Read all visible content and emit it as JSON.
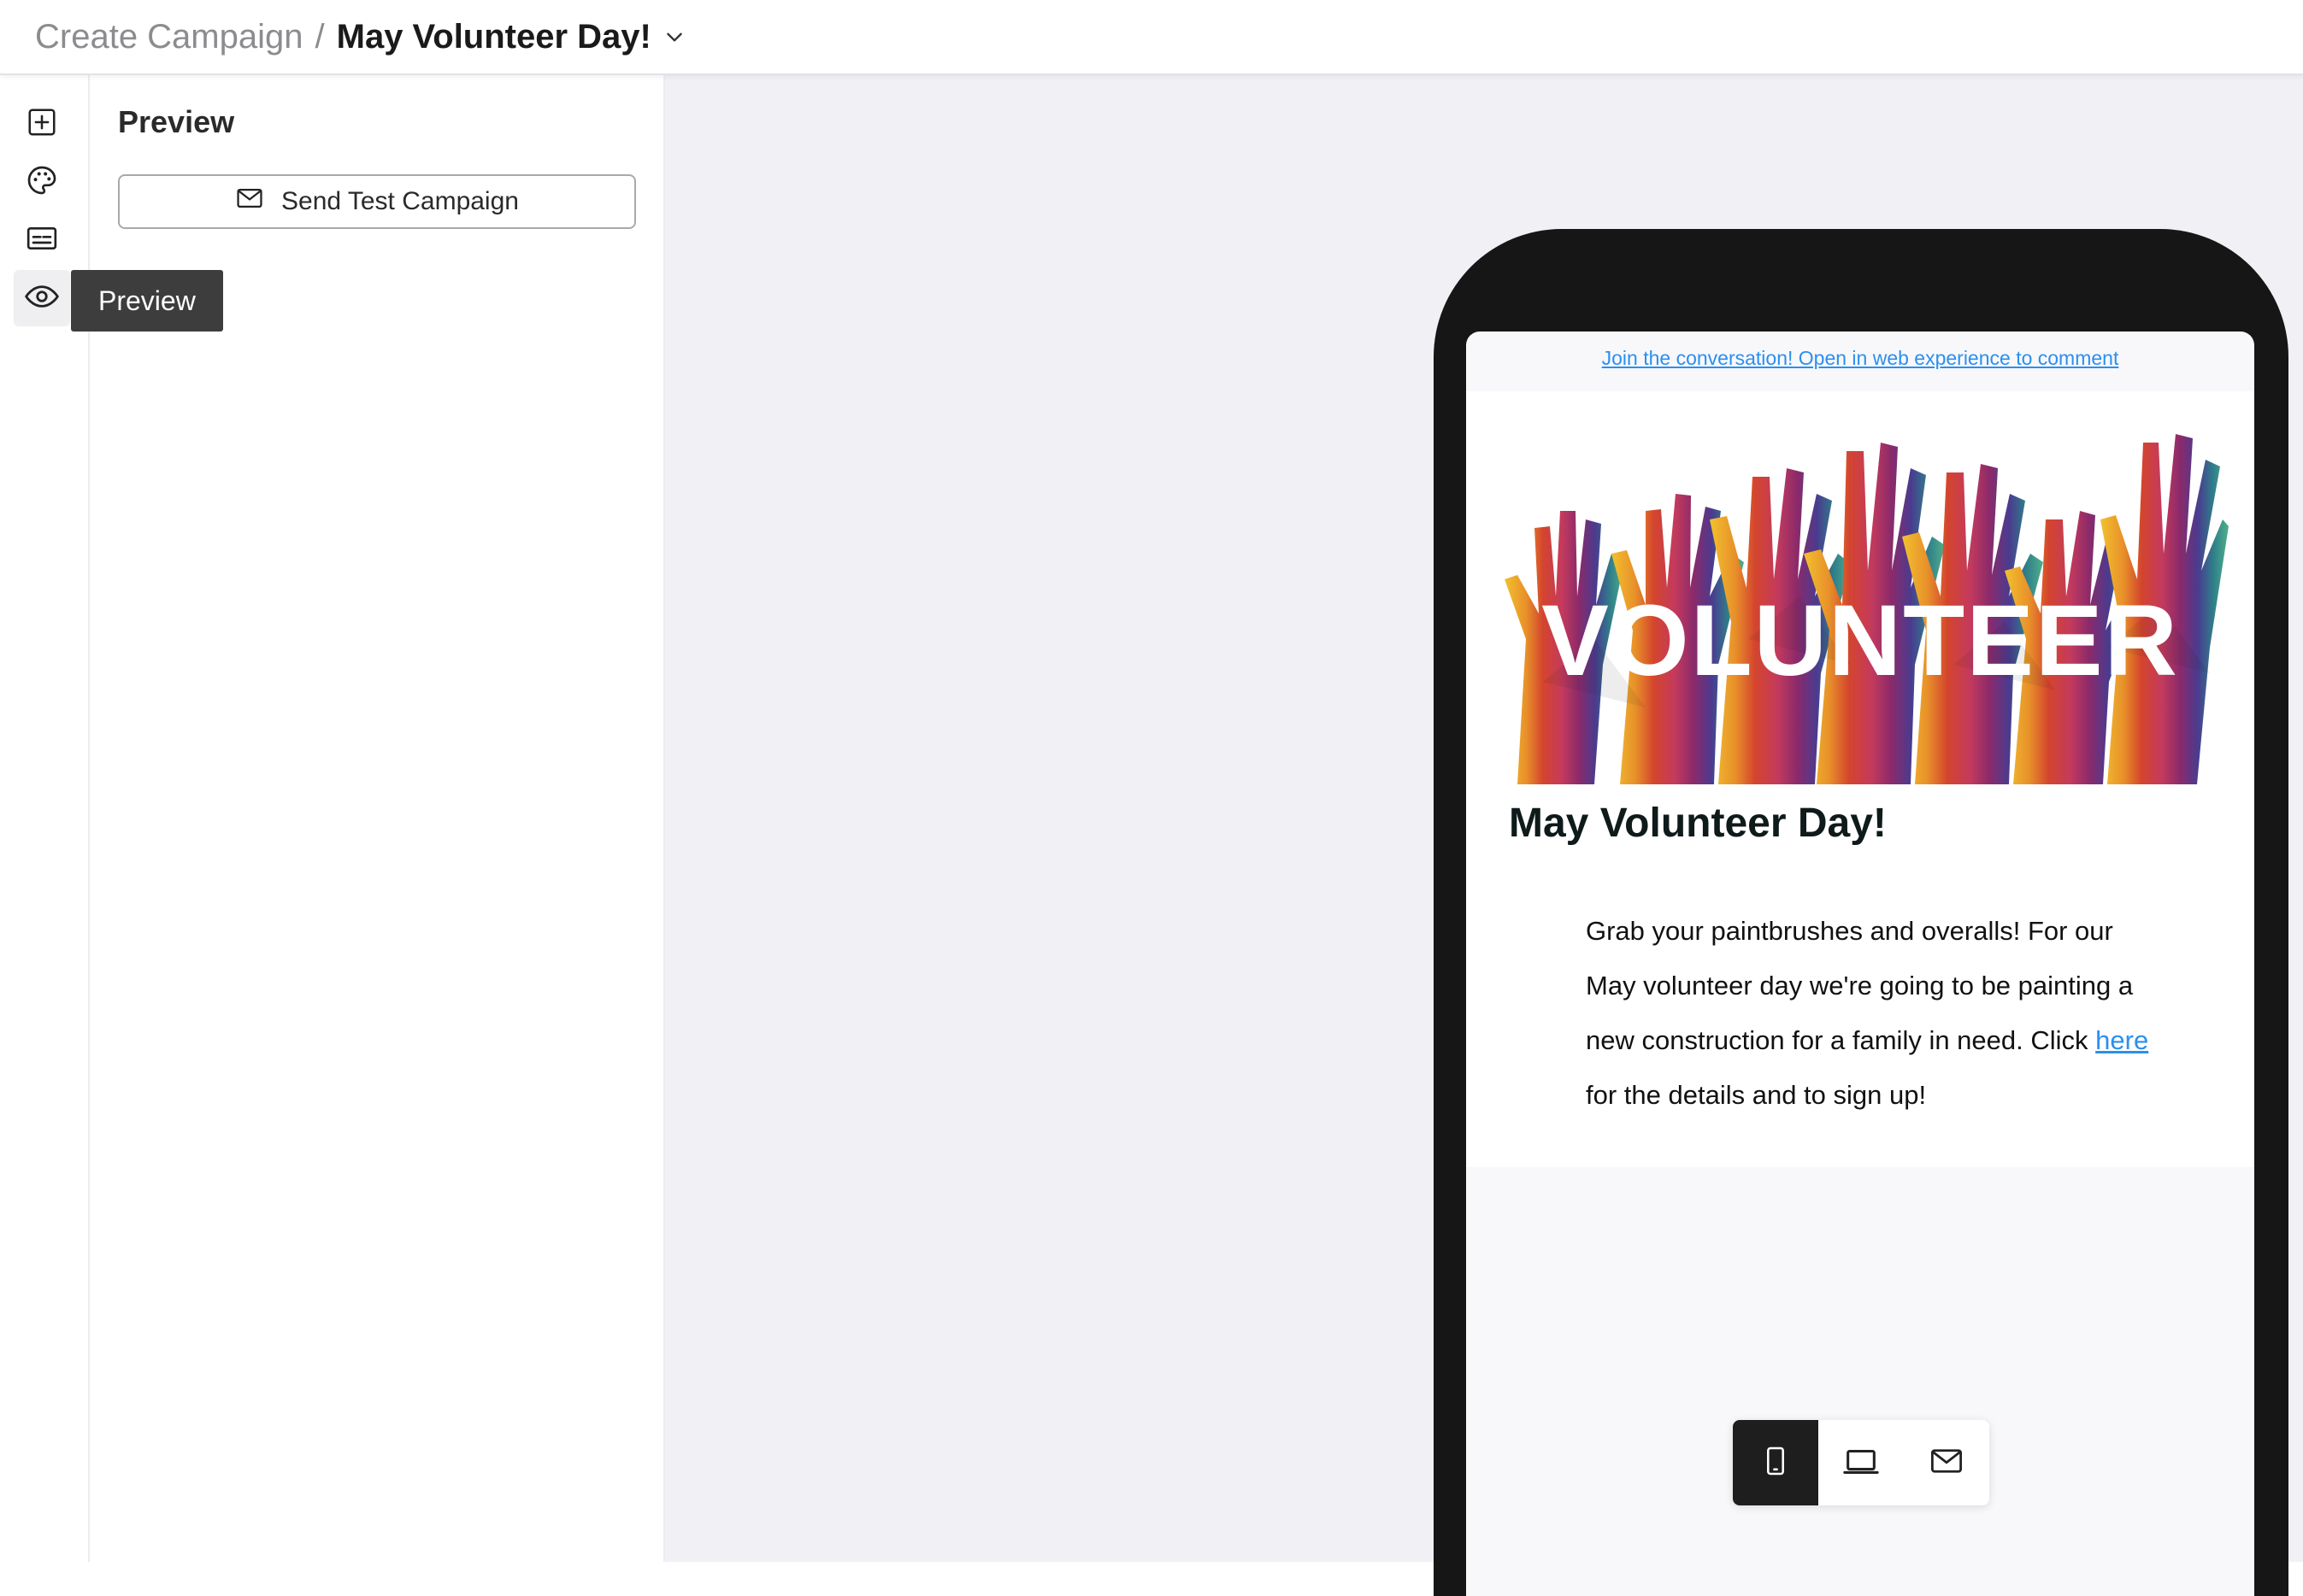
{
  "breadcrumb": {
    "parent": "Create Campaign",
    "separator": "/",
    "current": "May Volunteer Day!"
  },
  "sidebar": {
    "tooltip": "Preview",
    "items": [
      {
        "icon": "add-block-icon"
      },
      {
        "icon": "palette-icon"
      },
      {
        "icon": "subtitles-icon"
      },
      {
        "icon": "eye-icon",
        "active": true
      }
    ]
  },
  "panel": {
    "title": "Preview",
    "send_test_label": "Send Test Campaign"
  },
  "email": {
    "web_link": "Join the conversation! Open in web experience to comment",
    "hero_text": "VOLUNTEER",
    "title": "May Volunteer Day!",
    "body_before": "Grab your paintbrushes and overalls! For our May volunteer day we're going to be painting a new construction for a family in need. Click ",
    "body_link": "here",
    "body_after": " for the details and to sign up!"
  },
  "device_toggle": {
    "options": [
      "mobile",
      "desktop",
      "email"
    ],
    "selected": "mobile"
  },
  "colors": {
    "accent_link": "#2b8ff0",
    "tooltip_bg": "#3d3d3d",
    "canvas_bg": "#f1f1f5",
    "phone_frame": "#161616"
  }
}
